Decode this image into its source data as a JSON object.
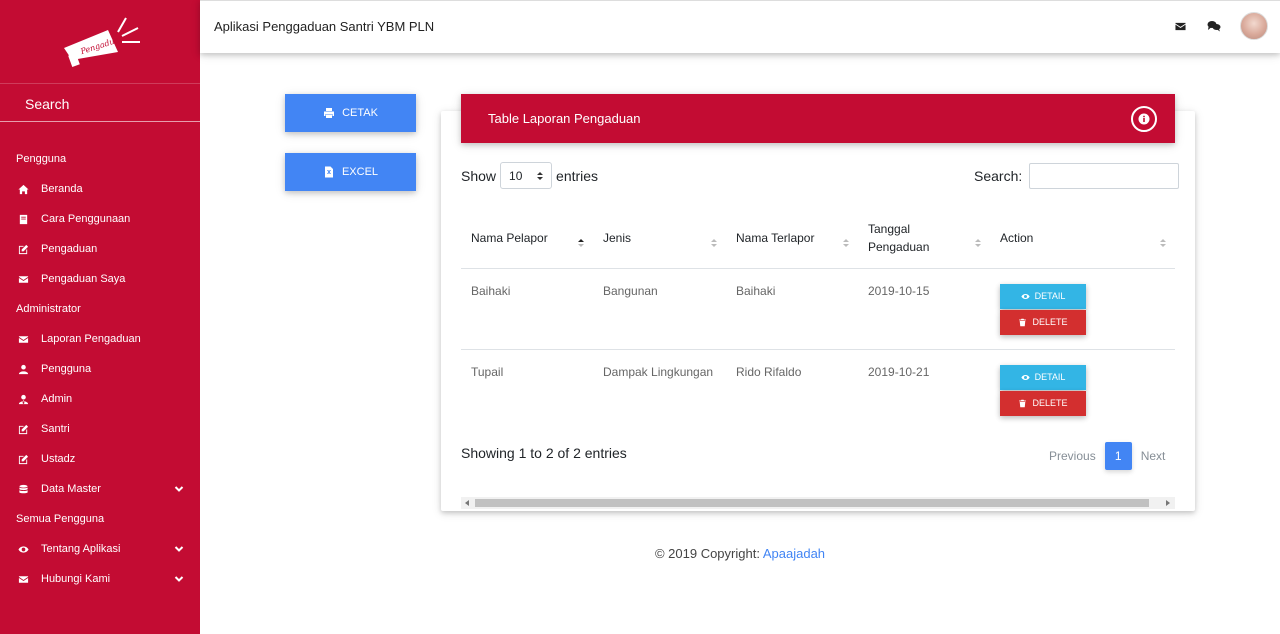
{
  "brand": {
    "logo_text": "Pengaduan"
  },
  "sidebar": {
    "search_label": "Search",
    "sections": [
      {
        "title": "Pengguna"
      },
      {
        "title": "Administrator"
      },
      {
        "title": "Semua Pengguna"
      }
    ],
    "items": [
      {
        "label": "Beranda",
        "icon": "home-icon"
      },
      {
        "label": "Cara Penggunaan",
        "icon": "book-icon"
      },
      {
        "label": "Pengaduan",
        "icon": "edit-icon"
      },
      {
        "label": "Pengaduan Saya",
        "icon": "envelope-icon"
      },
      {
        "label": "Laporan Pengaduan",
        "icon": "envelope-icon"
      },
      {
        "label": "Pengguna",
        "icon": "user-icon"
      },
      {
        "label": "Admin",
        "icon": "user-tie-icon"
      },
      {
        "label": "Santri",
        "icon": "edit-icon"
      },
      {
        "label": "Ustadz",
        "icon": "edit-icon"
      },
      {
        "label": "Data Master",
        "icon": "database-icon"
      },
      {
        "label": "Tentang Aplikasi",
        "icon": "eye-icon"
      },
      {
        "label": "Hubungi Kami",
        "icon": "envelope-icon"
      }
    ]
  },
  "topbar": {
    "title": "Aplikasi Penggaduan Santri YBM PLN",
    "icons": [
      "envelope-icon",
      "comments-icon"
    ]
  },
  "actions": {
    "print_label": "CETAK",
    "excel_label": "EXCEL"
  },
  "card": {
    "title": "Table Laporan Pengaduan",
    "show_label": "Show",
    "entries_label": "entries",
    "page_size": "10",
    "search_label": "Search:",
    "columns": [
      "Nama Pelapor",
      "Jenis",
      "Nama Terlapor",
      "Tanggal Pengaduan",
      "Action"
    ],
    "rows": [
      {
        "pelapor": "Baihaki",
        "jenis": "Bangunan",
        "terlapor": "Baihaki",
        "tanggal": "2019-10-15"
      },
      {
        "pelapor": "Tupail",
        "jenis": "Dampak Lingkungan",
        "terlapor": "Rido Rifaldo",
        "tanggal": "2019-10-21"
      }
    ],
    "detail_label": "DETAIL",
    "delete_label": "DELETE",
    "info": "Showing 1 to 2 of 2 entries",
    "pagination": {
      "previous": "Previous",
      "current": "1",
      "next": "Next"
    }
  },
  "footer": {
    "prefix": "© 2019 Copyright:",
    "link": "Apaajadah"
  },
  "colors": {
    "primary": "#c30c33",
    "blue": "#4285f4",
    "info": "#33b5e5",
    "danger": "#d32f2f"
  }
}
